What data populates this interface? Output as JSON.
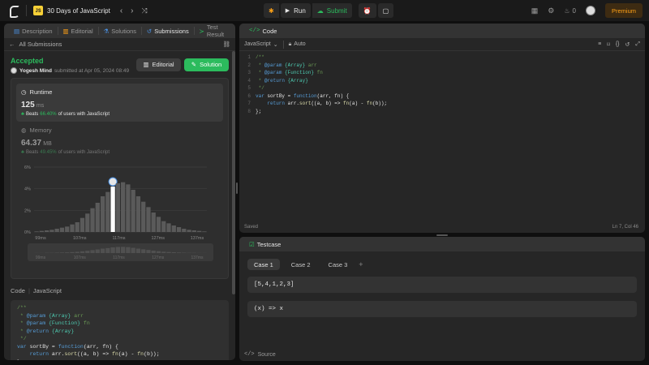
{
  "topbar": {
    "title": "30 Days of JavaScript",
    "js_badge": "JS",
    "run": "Run",
    "submit": "Submit",
    "points": "0",
    "premium": "Premium"
  },
  "left": {
    "tabs": [
      "Description",
      "Editorial",
      "Solutions",
      "Submissions",
      "Test Result"
    ],
    "back": "All Submissions",
    "status": "Accepted",
    "user": "Yogesh Mind",
    "submitted": "submitted at Apr 05, 2024 08:49",
    "editorial_btn": "Editorial",
    "solution_btn": "Solution",
    "runtime_label": "Runtime",
    "runtime_value": "125",
    "runtime_unit": "ms",
    "runtime_beats_pre": "Beats",
    "runtime_beats_pct": "66.40%",
    "runtime_beats_post": "of users with JavaScript",
    "memory_label": "Memory",
    "memory_value": "64.37",
    "memory_unit": "MB",
    "memory_beats_pre": "Beats",
    "memory_beats_pct": "49.45%",
    "memory_beats_post": "of users with JavaScript",
    "code_label": "Code",
    "code_lang": "JavaScript"
  },
  "chart_data": {
    "type": "bar",
    "y_ticks": [
      "6%",
      "4%",
      "2%",
      "0%"
    ],
    "ylim": [
      0,
      6
    ],
    "x_ticks": [
      "99ms",
      "107ms",
      "117ms",
      "127ms",
      "137ms"
    ],
    "highlight_index": 15,
    "values": [
      0.05,
      0.1,
      0.15,
      0.2,
      0.3,
      0.4,
      0.5,
      0.7,
      0.9,
      1.3,
      1.7,
      2.2,
      2.7,
      3.3,
      3.7,
      4.2,
      4.5,
      4.6,
      4.4,
      3.9,
      3.3,
      2.8,
      2.3,
      1.8,
      1.4,
      1.0,
      0.8,
      0.6,
      0.45,
      0.3,
      0.2,
      0.15,
      0.1,
      0.05
    ],
    "mini_ticks": [
      "99ms",
      "107ms",
      "117ms",
      "127ms",
      "137ms"
    ]
  },
  "code": {
    "header": "Code",
    "lang": "JavaScript",
    "mode": "Auto",
    "saved": "Saved",
    "cursor": "Ln 7, Col 46",
    "lines": [
      "/**",
      " * @param {Array} arr",
      " * @param {Function} fn",
      " * @return {Array}",
      " */",
      "var sortBy = function(arr, fn) {",
      "    return arr.sort((a, b) => fn(a) - fn(b));",
      "};"
    ]
  },
  "testcase": {
    "header": "Testcase",
    "cases": [
      "Case 1",
      "Case 2",
      "Case 3"
    ],
    "inputs": [
      "[5,4,1,2,3]",
      "(x) => x"
    ],
    "source": "Source"
  }
}
